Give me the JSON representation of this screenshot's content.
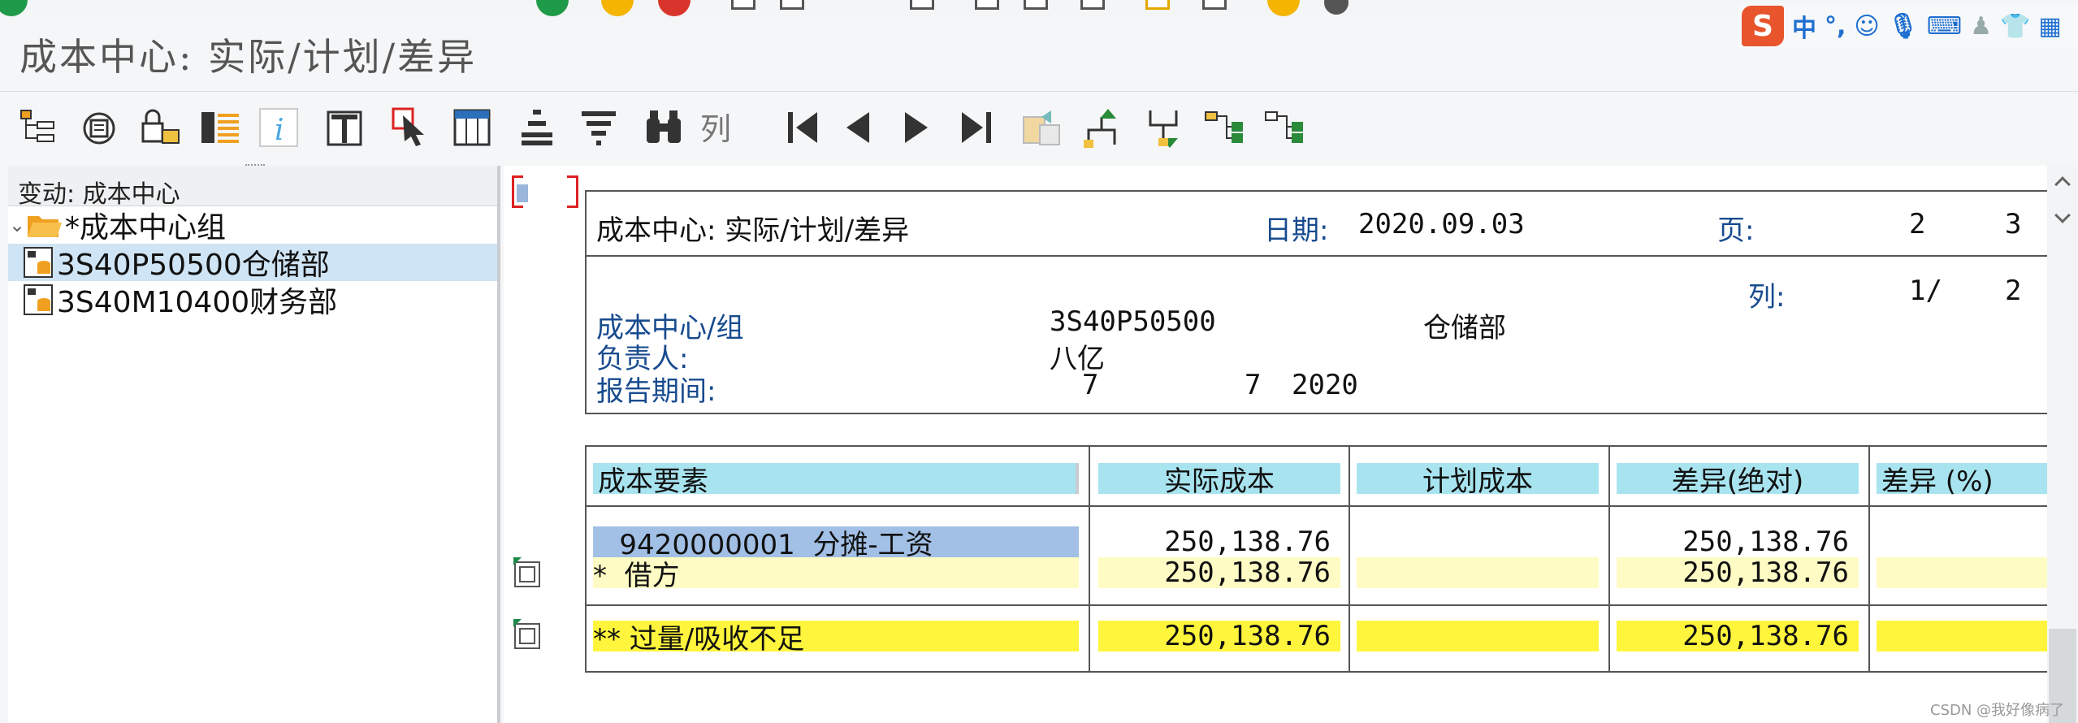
{
  "app": {
    "title": "成本中心: 实际/计划/差异",
    "column_button_label": "列",
    "ime": {
      "brand": "S",
      "lang": "中",
      "punct": "°,"
    },
    "watermark": "CSDN @我好像病了"
  },
  "tree": {
    "header": "变动:  成本中心",
    "group": {
      "toggle": "⌄",
      "label": "*成本中心组"
    },
    "items": [
      {
        "label": "3S40P50500仓储部",
        "selected": true
      },
      {
        "label": "3S40M10400财务部",
        "selected": false
      }
    ]
  },
  "report": {
    "header": {
      "title": "成本中心: 实际/计划/差异",
      "date_label": "日期:",
      "date_value": "2020.09.03",
      "page_label": "页:",
      "page_value": "2",
      "page_total": "3",
      "column_label": "列:",
      "column_value": "1/",
      "column_total": "2",
      "group_label": "成本中心/组",
      "group_code": "3S40P50500",
      "group_name": "仓储部",
      "owner_label": "负责人:",
      "owner_value": "八亿",
      "period_label": "报告期间:",
      "period_from": "7",
      "period_to": "7",
      "period_year": "2020"
    },
    "table": {
      "columns": [
        "成本要素",
        "实际成本",
        "计划成本",
        "差异(绝对)",
        "差异 (%)"
      ],
      "rows": [
        {
          "label": "   9420000001  分摊-工资",
          "actual": "250,138.76",
          "plan": "",
          "variance": "250,138.76",
          "pct": ""
        },
        {
          "label": "*  借方",
          "actual": "250,138.76",
          "plan": "",
          "variance": "250,138.76",
          "pct": ""
        },
        {
          "label": "** 过量/吸收不足",
          "actual": "250,138.76",
          "plan": "",
          "variance": "250,138.76",
          "pct": ""
        }
      ]
    }
  }
}
